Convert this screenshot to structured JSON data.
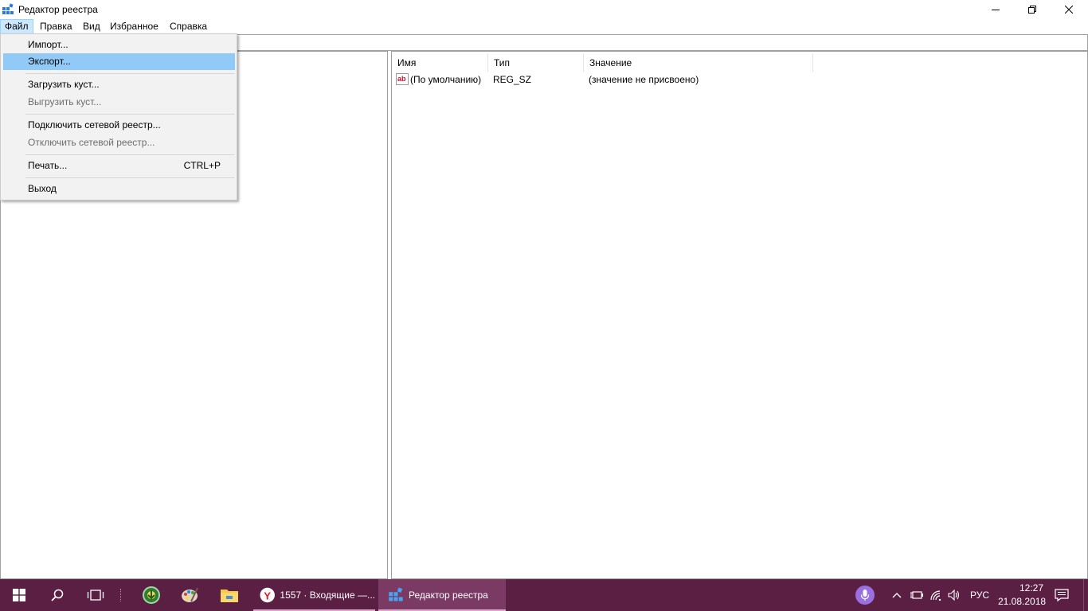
{
  "window": {
    "title": "Редактор реестра",
    "minimize_icon": "minimize-icon",
    "restore_icon": "restore-icon",
    "close_icon": "close-icon"
  },
  "menubar": {
    "items": [
      "Файл",
      "Правка",
      "Вид",
      "Избранное",
      "Справка"
    ]
  },
  "file_menu": {
    "items": [
      {
        "label": "Импорт...",
        "shortcut": "",
        "disabled": false,
        "highlighted": false
      },
      {
        "label": "Экспорт...",
        "shortcut": "",
        "disabled": false,
        "highlighted": true
      },
      {
        "label": "Загрузить куст...",
        "shortcut": "",
        "disabled": false,
        "highlighted": false
      },
      {
        "label": "Выгрузить куст...",
        "shortcut": "",
        "disabled": true,
        "highlighted": false
      },
      {
        "label": "Подключить сетевой реестр...",
        "shortcut": "",
        "disabled": false,
        "highlighted": false
      },
      {
        "label": "Отключить сетевой реестр...",
        "shortcut": "",
        "disabled": true,
        "highlighted": false
      },
      {
        "label": "Печать...",
        "shortcut": "CTRL+P",
        "disabled": false,
        "highlighted": false
      },
      {
        "label": "Выход",
        "shortcut": "",
        "disabled": false,
        "highlighted": false
      }
    ]
  },
  "list": {
    "columns": [
      "Имя",
      "Тип",
      "Значение"
    ],
    "rows": [
      {
        "icon": "string-value-icon",
        "name": "(По умолчанию)",
        "type": "REG_SZ",
        "value": "(значение не присвоено)"
      }
    ]
  },
  "taskbar": {
    "start_icon": "windows-start-icon",
    "search_icon": "search-icon",
    "task_view_icon": "task-view-icon",
    "apps": [
      {
        "icon": "green-app-icon",
        "label": ""
      },
      {
        "icon": "paint-palette-icon",
        "label": ""
      },
      {
        "icon": "file-explorer-icon",
        "label": ""
      },
      {
        "icon": "yandex-browser-icon",
        "label": "1557 · Входящие —..."
      },
      {
        "icon": "registry-editor-icon",
        "label": "Редактор реестра"
      }
    ],
    "tray": {
      "language": "РУС",
      "time": "12:27",
      "date": "21.08.2018"
    }
  },
  "colors": {
    "taskbar": "#5b1f43",
    "menu_highlight": "#91c9f7",
    "cortana": "#9a6fe0"
  }
}
